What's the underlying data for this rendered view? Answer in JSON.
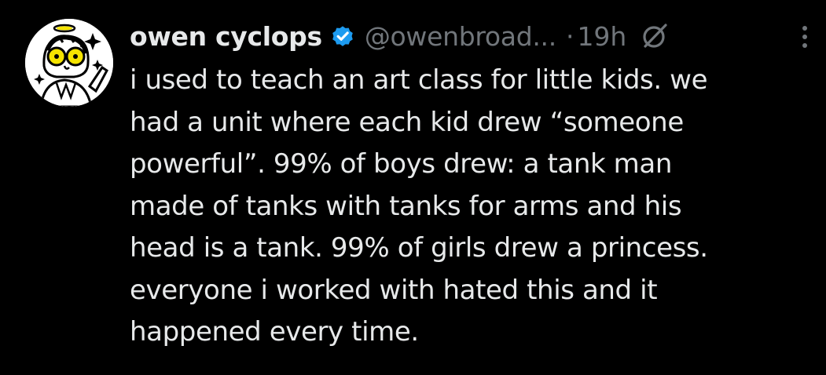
{
  "tweet": {
    "author": {
      "display_name": "owen cyclops",
      "handle": "@owenbroad...",
      "verified": true,
      "avatar_icon": "cyclops-avatar-icon"
    },
    "separator": "·",
    "timestamp": "19h",
    "header_icons": {
      "grok": "grok-icon",
      "more": "more-options-icon"
    },
    "text_lines": [
      "i used to teach an art class for little kids. we",
      "had a unit where each kid drew “someone",
      "powerful”. 99% of boys drew: a tank man",
      "made of tanks with tanks for arms and his",
      "head is a tank. 99% of girls drew a princess.",
      "everyone i worked with hated this and it",
      "happened every time."
    ]
  },
  "colors": {
    "background": "#000000",
    "primary_text": "#e7e9ea",
    "secondary_text": "#71767b",
    "verified_badge": "#1d9bf0",
    "avatar_accent": "#f5e400"
  }
}
